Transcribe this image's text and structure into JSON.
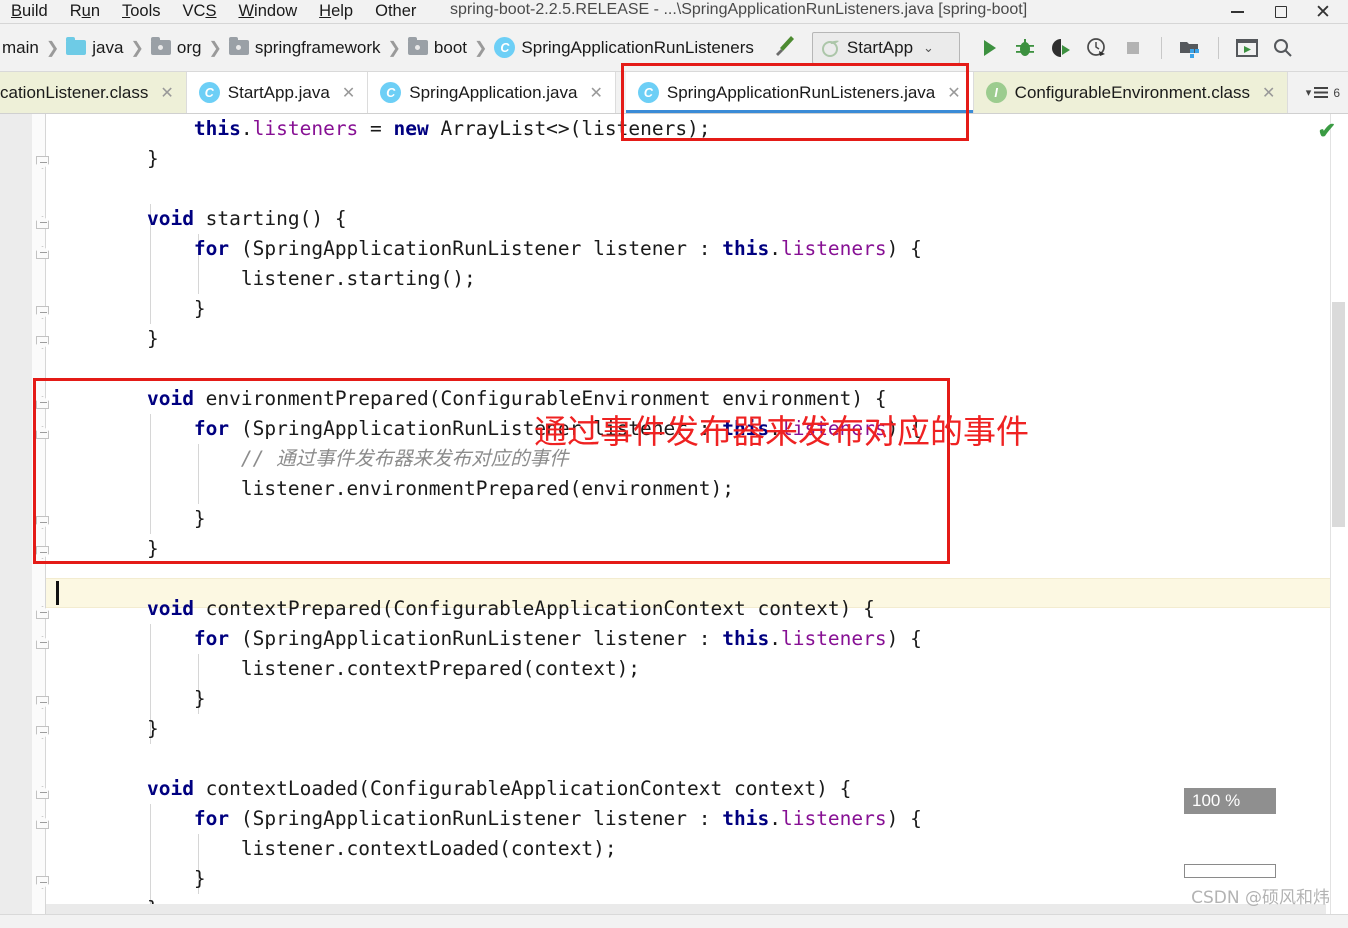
{
  "window": {
    "title": "spring-boot-2.2.5.RELEASE - ...\\SpringApplicationRunListeners.java [spring-boot]",
    "minimize": "–",
    "maximize": "▢",
    "close": "✕"
  },
  "menubar": {
    "items": [
      {
        "label": "Build",
        "mnemonic": "B"
      },
      {
        "label": "Run",
        "mnemonic": "u"
      },
      {
        "label": "Tools",
        "mnemonic": "T"
      },
      {
        "label": "VCS",
        "mnemonic": "S"
      },
      {
        "label": "Window",
        "mnemonic": "W"
      },
      {
        "label": "Help",
        "mnemonic": "H"
      },
      {
        "label": "Other",
        "mnemonic": ""
      }
    ]
  },
  "breadcrumb": {
    "items": [
      {
        "label": "main",
        "icon": "none"
      },
      {
        "label": "java",
        "icon": "folder-blue"
      },
      {
        "label": "org",
        "icon": "folder-gray"
      },
      {
        "label": "springframework",
        "icon": "folder-gray"
      },
      {
        "label": "boot",
        "icon": "folder-gray"
      },
      {
        "label": "SpringApplicationRunListeners",
        "icon": "class-icon"
      }
    ],
    "separator": "❯"
  },
  "toolbar": {
    "build_icon": "hammer-icon",
    "run_config": {
      "name": "StartApp",
      "icon": "spring-boot-icon",
      "chevron": "∨"
    },
    "buttons": [
      {
        "name": "run-button",
        "icon": "play-icon",
        "color": "#3d9140"
      },
      {
        "name": "debug-button",
        "icon": "bug-icon",
        "color": "#3d9140"
      },
      {
        "name": "run-with-coverage-button",
        "icon": "coverage-icon",
        "color": "#3d9140"
      },
      {
        "name": "profiler-button",
        "icon": "profiler-icon",
        "color": "#4a4a4a"
      },
      {
        "name": "stop-button",
        "icon": "stop-icon",
        "color": "#b3b3b3"
      },
      {
        "name": "project-structure-button",
        "icon": "project-structure-icon",
        "color": "#4a4a4a"
      },
      {
        "name": "maximize-window-button",
        "icon": "window-icon",
        "color": "#4a4a4a"
      },
      {
        "name": "search-button",
        "icon": "search-icon",
        "color": "#4a4a4a"
      }
    ]
  },
  "tabs": {
    "items": [
      {
        "label": "cationListener.class",
        "icon": "class-icon",
        "state": "compiled",
        "close": "✕"
      },
      {
        "label": "StartApp.java",
        "icon": "class-runnable-icon",
        "state": "normal",
        "close": "✕"
      },
      {
        "label": "SpringApplication.java",
        "icon": "class-runnable-icon",
        "state": "normal",
        "close": "✕"
      },
      {
        "label": "SpringApplicationRunListeners.java",
        "icon": "class-icon",
        "state": "active",
        "close": "✕"
      },
      {
        "label": "ConfigurableEnvironment.class",
        "icon": "interface-icon",
        "state": "compiled",
        "close": "✕"
      }
    ],
    "overflow_label": "6",
    "overflow_icon": "tab-list-icon"
  },
  "editor": {
    "lines": [
      {
        "n": 1,
        "indent": 2,
        "tokens": [
          {
            "t": "this",
            "c": "kw"
          },
          {
            "t": ".",
            "c": "plain"
          },
          {
            "t": "listeners",
            "c": "fld"
          },
          {
            "t": " = ",
            "c": "plain"
          },
          {
            "t": "new",
            "c": "kw"
          },
          {
            "t": " ArrayList<>(listeners);",
            "c": "plain"
          }
        ]
      },
      {
        "n": 2,
        "indent": 1,
        "tokens": [
          {
            "t": "}",
            "c": "plain"
          }
        ]
      },
      {
        "n": 3,
        "indent": 0,
        "tokens": []
      },
      {
        "n": 4,
        "indent": 1,
        "tokens": [
          {
            "t": "void",
            "c": "kw"
          },
          {
            "t": " starting() {",
            "c": "plain"
          }
        ]
      },
      {
        "n": 5,
        "indent": 2,
        "tokens": [
          {
            "t": "for",
            "c": "kw"
          },
          {
            "t": " (SpringApplicationRunListener listener : ",
            "c": "plain"
          },
          {
            "t": "this",
            "c": "kw"
          },
          {
            "t": ".",
            "c": "plain"
          },
          {
            "t": "listeners",
            "c": "fld"
          },
          {
            "t": ") {",
            "c": "plain"
          }
        ]
      },
      {
        "n": 6,
        "indent": 3,
        "tokens": [
          {
            "t": "listener.starting();",
            "c": "plain"
          }
        ]
      },
      {
        "n": 7,
        "indent": 2,
        "tokens": [
          {
            "t": "}",
            "c": "plain"
          }
        ]
      },
      {
        "n": 8,
        "indent": 1,
        "tokens": [
          {
            "t": "}",
            "c": "plain"
          }
        ]
      },
      {
        "n": 9,
        "indent": 0,
        "tokens": []
      },
      {
        "n": 10,
        "indent": 1,
        "tokens": [
          {
            "t": "void",
            "c": "kw"
          },
          {
            "t": " environmentPrepared(ConfigurableEnvironment environment) {",
            "c": "plain"
          }
        ]
      },
      {
        "n": 11,
        "indent": 2,
        "tokens": [
          {
            "t": "for",
            "c": "kw"
          },
          {
            "t": " (SpringApplicationRunListener listener : ",
            "c": "plain"
          },
          {
            "t": "this",
            "c": "kw"
          },
          {
            "t": ".",
            "c": "plain"
          },
          {
            "t": "listeners",
            "c": "fld"
          },
          {
            "t": ") {",
            "c": "plain"
          }
        ]
      },
      {
        "n": 12,
        "indent": 3,
        "tokens": [
          {
            "t": "// 通过事件发布器来发布对应的事件",
            "c": "cmt"
          }
        ]
      },
      {
        "n": 13,
        "indent": 3,
        "tokens": [
          {
            "t": "listener.environmentPrepared(environment);",
            "c": "plain"
          }
        ]
      },
      {
        "n": 14,
        "indent": 2,
        "tokens": [
          {
            "t": "}",
            "c": "plain"
          }
        ]
      },
      {
        "n": 15,
        "indent": 1,
        "tokens": [
          {
            "t": "}",
            "c": "plain"
          }
        ]
      },
      {
        "n": 16,
        "indent": 0,
        "tokens": [],
        "current": true
      },
      {
        "n": 17,
        "indent": 1,
        "tokens": [
          {
            "t": "void",
            "c": "kw"
          },
          {
            "t": " contextPrepared(ConfigurableApplicationContext context) {",
            "c": "plain"
          }
        ]
      },
      {
        "n": 18,
        "indent": 2,
        "tokens": [
          {
            "t": "for",
            "c": "kw"
          },
          {
            "t": " (SpringApplicationRunListener listener : ",
            "c": "plain"
          },
          {
            "t": "this",
            "c": "kw"
          },
          {
            "t": ".",
            "c": "plain"
          },
          {
            "t": "listeners",
            "c": "fld"
          },
          {
            "t": ") {",
            "c": "plain"
          }
        ]
      },
      {
        "n": 19,
        "indent": 3,
        "tokens": [
          {
            "t": "listener.contextPrepared(context);",
            "c": "plain"
          }
        ]
      },
      {
        "n": 20,
        "indent": 2,
        "tokens": [
          {
            "t": "}",
            "c": "plain"
          }
        ]
      },
      {
        "n": 21,
        "indent": 1,
        "tokens": [
          {
            "t": "}",
            "c": "plain"
          }
        ]
      },
      {
        "n": 22,
        "indent": 0,
        "tokens": []
      },
      {
        "n": 23,
        "indent": 1,
        "tokens": [
          {
            "t": "void",
            "c": "kw"
          },
          {
            "t": " contextLoaded(ConfigurableApplicationContext context) {",
            "c": "plain"
          }
        ]
      },
      {
        "n": 24,
        "indent": 2,
        "tokens": [
          {
            "t": "for",
            "c": "kw"
          },
          {
            "t": " (SpringApplicationRunListener listener : ",
            "c": "plain"
          },
          {
            "t": "this",
            "c": "kw"
          },
          {
            "t": ".",
            "c": "plain"
          },
          {
            "t": "listeners",
            "c": "fld"
          },
          {
            "t": ") {",
            "c": "plain"
          }
        ]
      },
      {
        "n": 25,
        "indent": 3,
        "tokens": [
          {
            "t": "listener.contextLoaded(context);",
            "c": "plain"
          }
        ]
      },
      {
        "n": 26,
        "indent": 2,
        "tokens": [
          {
            "t": "}",
            "c": "plain"
          }
        ]
      },
      {
        "n": 27,
        "indent": 1,
        "tokens": [
          {
            "t": "}",
            "c": "plain"
          }
        ]
      }
    ]
  },
  "annotations": {
    "note_text": "通过事件发布器来发布对应的事件",
    "note_color": "#ef2222",
    "box_color": "#e41b17"
  },
  "right_rail": {
    "inspection_status_icon": "checkmark-icon",
    "inspection_status_color": "#3a9b43",
    "zoom_level": "100 %"
  },
  "watermark": "CSDN @硕风和炜",
  "colors": {
    "keyword": "#000080",
    "field": "#871094",
    "comment": "#8c8c8c",
    "accent": "#3a8bd6",
    "tab_compiled_bg": "#eef0d8",
    "current_line_bg": "#fcf8e2"
  }
}
